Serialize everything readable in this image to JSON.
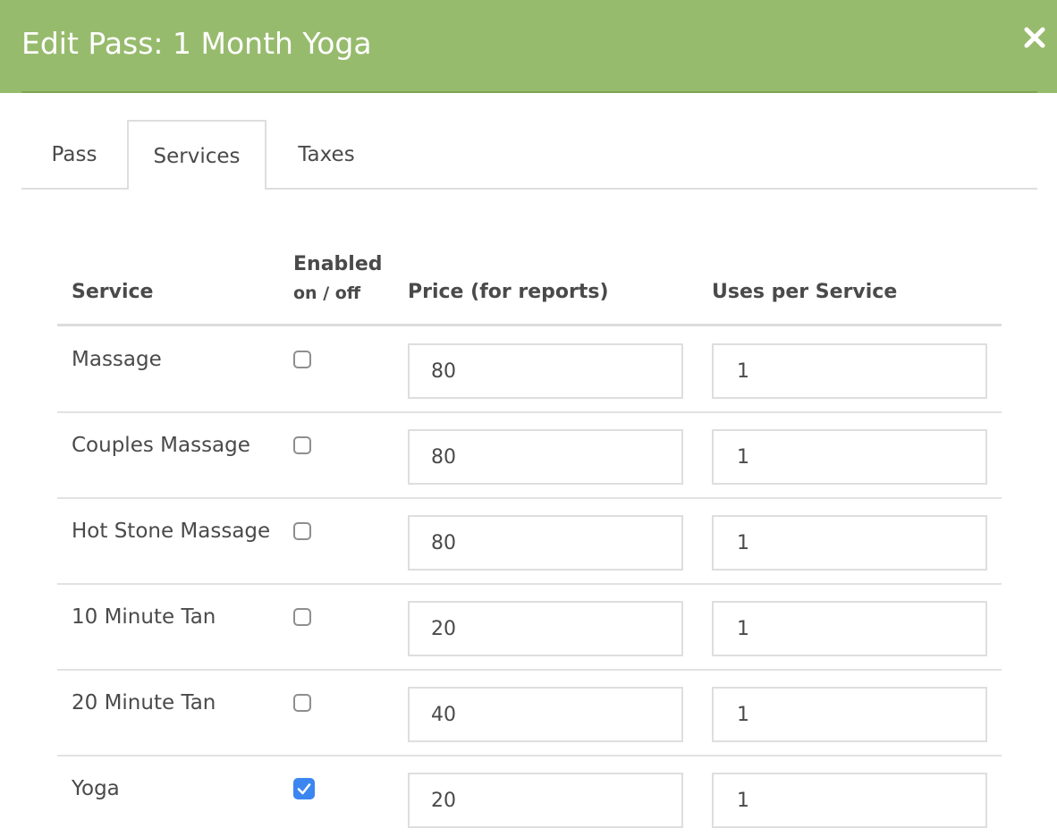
{
  "header": {
    "title": "Edit Pass: 1 Month Yoga",
    "close_icon": "close-icon",
    "color": "#97bb6d"
  },
  "tabs": [
    {
      "label": "Pass",
      "active": false
    },
    {
      "label": "Services",
      "active": true
    },
    {
      "label": "Taxes",
      "active": false
    }
  ],
  "table": {
    "headers": {
      "service": "Service",
      "enabled": "Enabled",
      "enabled_sub": "on / off",
      "price": "Price (for reports)",
      "uses": "Uses per Service"
    },
    "rows": [
      {
        "service": "Massage",
        "enabled": false,
        "price": "80",
        "uses": "1"
      },
      {
        "service": "Couples Massage",
        "enabled": false,
        "price": "80",
        "uses": "1"
      },
      {
        "service": "Hot Stone Massage",
        "enabled": false,
        "price": "80",
        "uses": "1"
      },
      {
        "service": "10 Minute Tan",
        "enabled": false,
        "price": "20",
        "uses": "1"
      },
      {
        "service": "20 Minute Tan",
        "enabled": false,
        "price": "40",
        "uses": "1"
      },
      {
        "service": "Yoga",
        "enabled": true,
        "price": "20",
        "uses": "1"
      }
    ]
  },
  "colors": {
    "checkbox_checked": "#3b86f0"
  }
}
